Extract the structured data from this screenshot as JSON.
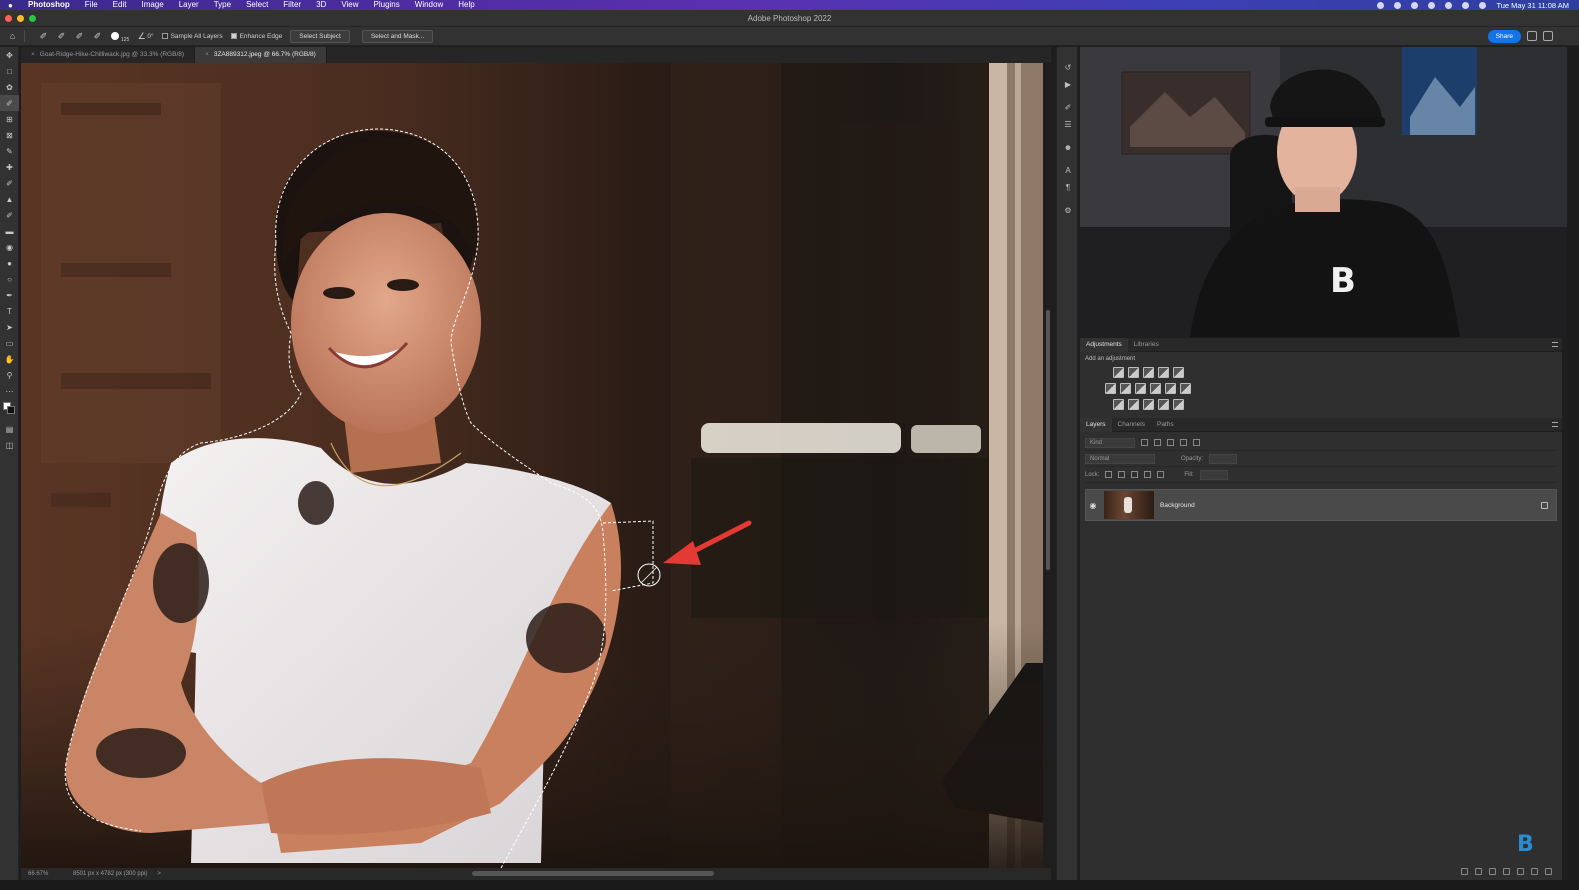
{
  "menubar": {
    "app": "Photoshop",
    "items": [
      "File",
      "Edit",
      "Image",
      "Layer",
      "Type",
      "Select",
      "Filter",
      "3D",
      "View",
      "Plugins",
      "Window",
      "Help"
    ],
    "clock": "Tue May 31  11:08 AM"
  },
  "window": {
    "title": "Adobe Photoshop 2022"
  },
  "options": {
    "brush_size": "125",
    "angle": "0°",
    "sample_all_layers": "Sample All Layers",
    "enhance_edge": "Enhance Edge",
    "select_subject": "Select Subject",
    "select_and_mask": "Select and Mask...",
    "share": "Share"
  },
  "tabs": [
    {
      "label": "Goat-Ridge-Hike-Chilliwack.jpg @ 33.3% (RGB/8)"
    },
    {
      "label": "3ZA889312.jpeg @ 66.7% (RGB/8)"
    }
  ],
  "panels": {
    "adjustments_tab": "Adjustments",
    "libraries_tab": "Libraries",
    "add_adjustment": "Add an adjustment",
    "layers_tab": "Layers",
    "channels_tab": "Channels",
    "paths_tab": "Paths",
    "kind": "Kind",
    "blend_mode": "Normal",
    "opacity_label": "Opacity:",
    "lock_label": "Lock:",
    "fill_label": "Fill:",
    "layer_name": "Background"
  },
  "status": {
    "zoom": "66.67%",
    "doc_info": "8501 px x 4782 px (300 ppi)",
    "arrow": ">"
  },
  "colors": {
    "accent": "#1473e6",
    "annotation_arrow": "#e53935",
    "menubar_start": "#3a2a8c",
    "menubar_end": "#2f3fa0"
  },
  "icons": {
    "brand_watermark": "B"
  }
}
